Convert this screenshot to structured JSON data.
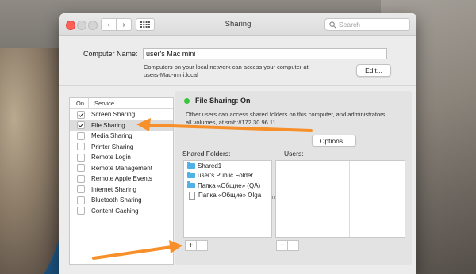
{
  "window": {
    "title": "Sharing",
    "search_placeholder": "Search",
    "nav_back": "‹",
    "nav_forward": "›"
  },
  "computer_name": {
    "label": "Computer Name:",
    "value": "user's Mac mini",
    "info_line1": "Computers on your local network can access your computer at:",
    "info_line2": "users-Mac-mini.local",
    "edit_button": "Edit..."
  },
  "services": {
    "header_on": "On",
    "header_service": "Service",
    "items": [
      {
        "label": "Screen Sharing",
        "checked": true,
        "selected": false
      },
      {
        "label": "File Sharing",
        "checked": true,
        "selected": true
      },
      {
        "label": "Media Sharing",
        "checked": false,
        "selected": false
      },
      {
        "label": "Printer Sharing",
        "checked": false,
        "selected": false
      },
      {
        "label": "Remote Login",
        "checked": false,
        "selected": false
      },
      {
        "label": "Remote Management",
        "checked": false,
        "selected": false
      },
      {
        "label": "Remote Apple Events",
        "checked": false,
        "selected": false
      },
      {
        "label": "Internet Sharing",
        "checked": false,
        "selected": false
      },
      {
        "label": "Bluetooth Sharing",
        "checked": false,
        "selected": false
      },
      {
        "label": "Content Caching",
        "checked": false,
        "selected": false
      }
    ]
  },
  "detail": {
    "status": "File Sharing: On",
    "status_color": "#36c53d",
    "description_line1": "Other users can access shared folders on this computer, and administrators",
    "description_line2": "all volumes, at smb://172.30.96.11",
    "options_button": "Options...",
    "shared_folders_label": "Shared Folders:",
    "users_label": "Users:",
    "shared_folders": [
      {
        "label": "Shared1",
        "icon": "folder-icon"
      },
      {
        "label": "user's Public Folder",
        "icon": "folder-icon"
      },
      {
        "label": "Папка «Общие» (QA)",
        "icon": "folder-icon"
      },
      {
        "label": "Папка «Общие» Olga",
        "icon": "document-icon"
      }
    ],
    "add_symbol": "+",
    "remove_symbol": "−"
  },
  "annotation": {
    "arrow_color": "#f7902a"
  }
}
